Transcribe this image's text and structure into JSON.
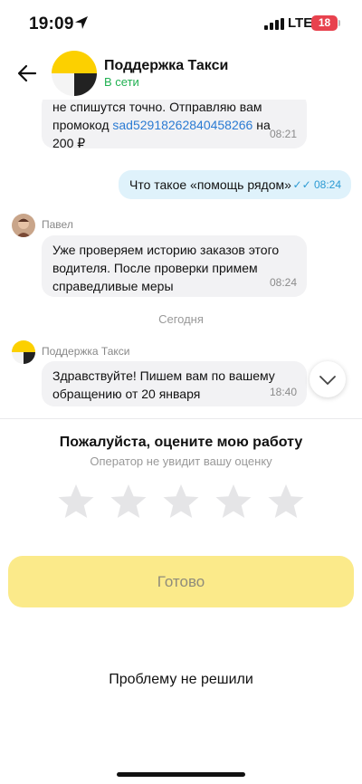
{
  "status_bar": {
    "time": "19:09",
    "network": "LTE",
    "battery": "18",
    "battery_color": "#e8424e"
  },
  "header": {
    "title": "Поддержка Такси",
    "status": "В сети",
    "status_color": "#22b153",
    "back_icon": "arrow-left-icon"
  },
  "messages": {
    "m1": {
      "text_before": "не спишутся точно. Отправляю вам промокод ",
      "promo": "sad52918262840458266",
      "text_after": " на 200 ₽",
      "time": "08:21"
    },
    "m2": {
      "text": "Что такое «помощь рядом»",
      "time": "08:24",
      "checks": "✓✓"
    },
    "m3": {
      "sender": "Павел",
      "text": "Уже проверяем историю заказов этого водителя. После проверки примем справедливые меры",
      "time": "08:24"
    },
    "date_separator": "Сегодня",
    "m4": {
      "sender": "Поддержка Такси",
      "text": "Здравствуйте! Пишем вам по вашему обращению от 20 января",
      "time": "18:40"
    }
  },
  "rating": {
    "title": "Пожалуйста, оцените мою работу",
    "subtitle": "Оператор не увидит вашу оценку",
    "max_stars": 5,
    "selected_stars": 0,
    "done_label": "Готово",
    "problem_label": "Проблему не решили",
    "accent_color": "#fbea8a"
  }
}
